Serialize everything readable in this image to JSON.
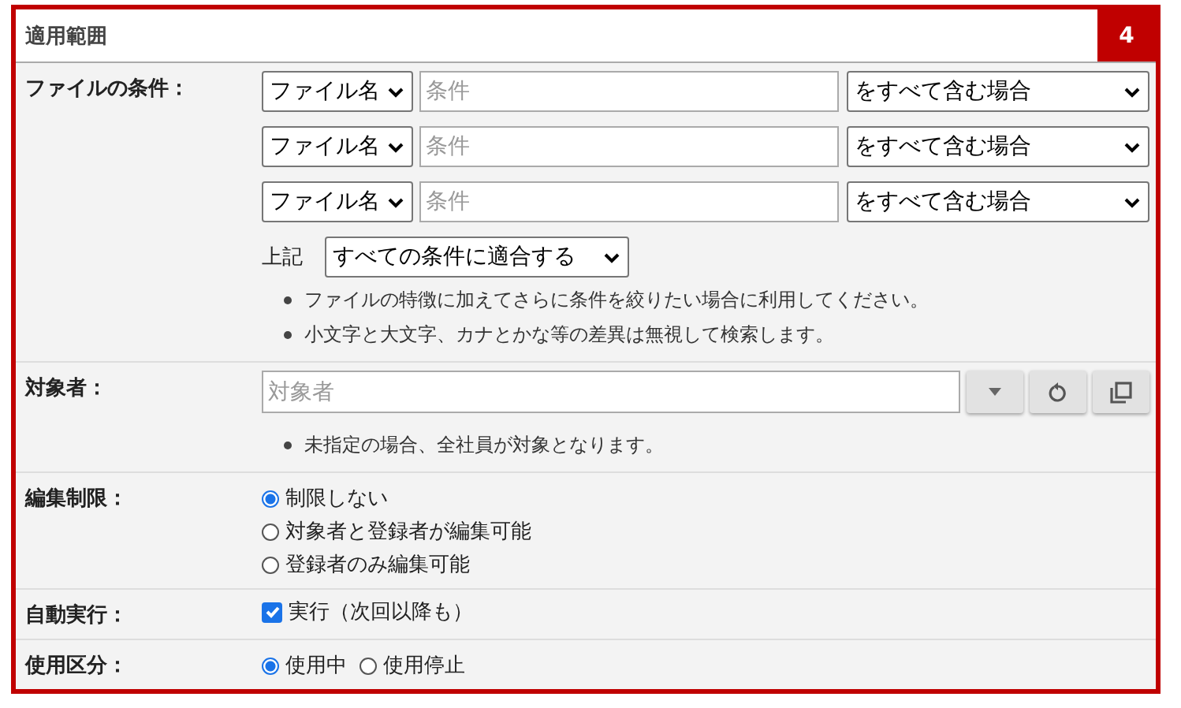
{
  "panel": {
    "title": "適用範囲",
    "badge": "4"
  },
  "sections": [
    {
      "kind": "conditions",
      "label": "ファイルの条件：",
      "rows": [
        {
          "field": "ファイル名",
          "placeholder": "条件",
          "match": "をすべて含む場合"
        },
        {
          "field": "ファイル名",
          "placeholder": "条件",
          "match": "をすべて含む場合"
        },
        {
          "field": "ファイル名",
          "placeholder": "条件",
          "match": "をすべて含む場合"
        }
      ],
      "combine_label": "上記",
      "combine": "すべての条件に適合する",
      "notes": [
        "ファイルの特徴に加えてさらに条件を絞りたい場合に利用してください。",
        "小文字と大文字、カナとかな等の差異は無視して検索します。"
      ]
    },
    {
      "kind": "picker",
      "label": "対象者：",
      "placeholder": "対象者",
      "notes": [
        "未指定の場合、全社員が対象となります。"
      ]
    },
    {
      "kind": "radio-list",
      "label": "編集制限：",
      "options": [
        {
          "label": "制限しない",
          "selected": true
        },
        {
          "label": "対象者と登録者が編集可能",
          "selected": false
        },
        {
          "label": "登録者のみ編集可能",
          "selected": false
        }
      ]
    },
    {
      "kind": "checkbox",
      "label": "自動実行：",
      "option": {
        "label": "実行（次回以降も）",
        "checked": true
      }
    },
    {
      "kind": "radio-inline",
      "label": "使用区分：",
      "options": [
        {
          "label": "使用中",
          "selected": true
        },
        {
          "label": "使用停止",
          "selected": false
        }
      ]
    }
  ]
}
